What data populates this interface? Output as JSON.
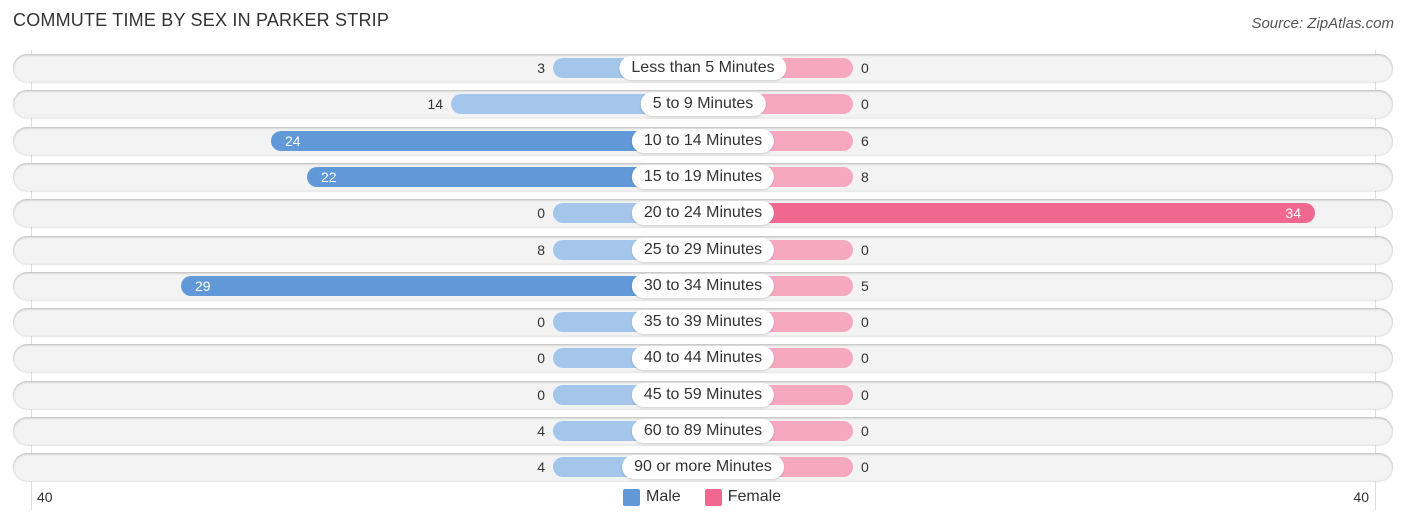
{
  "title": "COMMUTE TIME BY SEX IN PARKER STRIP",
  "source": "Source: ZipAtlas.com",
  "colors": {
    "male_strong": "#6199d8",
    "male_light": "#a4c6ea",
    "female_strong": "#f06890",
    "female_light": "#f7a8c1"
  },
  "chart_data": {
    "type": "bar",
    "orientation": "horizontal-diverging",
    "title": "COMMUTE TIME BY SEX IN PARKER STRIP",
    "categories": [
      "Less than 5 Minutes",
      "5 to 9 Minutes",
      "10 to 14 Minutes",
      "15 to 19 Minutes",
      "20 to 24 Minutes",
      "25 to 29 Minutes",
      "30 to 34 Minutes",
      "35 to 39 Minutes",
      "40 to 44 Minutes",
      "45 to 59 Minutes",
      "60 to 89 Minutes",
      "90 or more Minutes"
    ],
    "series": [
      {
        "name": "Male",
        "values": [
          3,
          14,
          24,
          22,
          0,
          8,
          29,
          0,
          0,
          0,
          4,
          4
        ]
      },
      {
        "name": "Female",
        "values": [
          0,
          0,
          6,
          8,
          34,
          0,
          5,
          0,
          0,
          0,
          0,
          0
        ]
      }
    ],
    "axis_min_label": "40",
    "axis_max_label": "40",
    "xlim": [
      -40,
      40
    ],
    "legend": [
      "Male",
      "Female"
    ],
    "legend_position": "bottom-center"
  }
}
